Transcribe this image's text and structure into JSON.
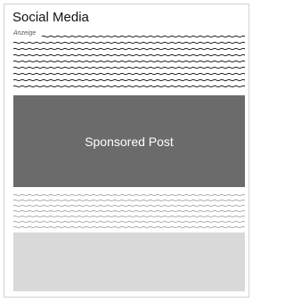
{
  "widget": {
    "title": "Social Media",
    "ad_label": "Anzeige",
    "sponsored_label": "Sponsored Post"
  }
}
